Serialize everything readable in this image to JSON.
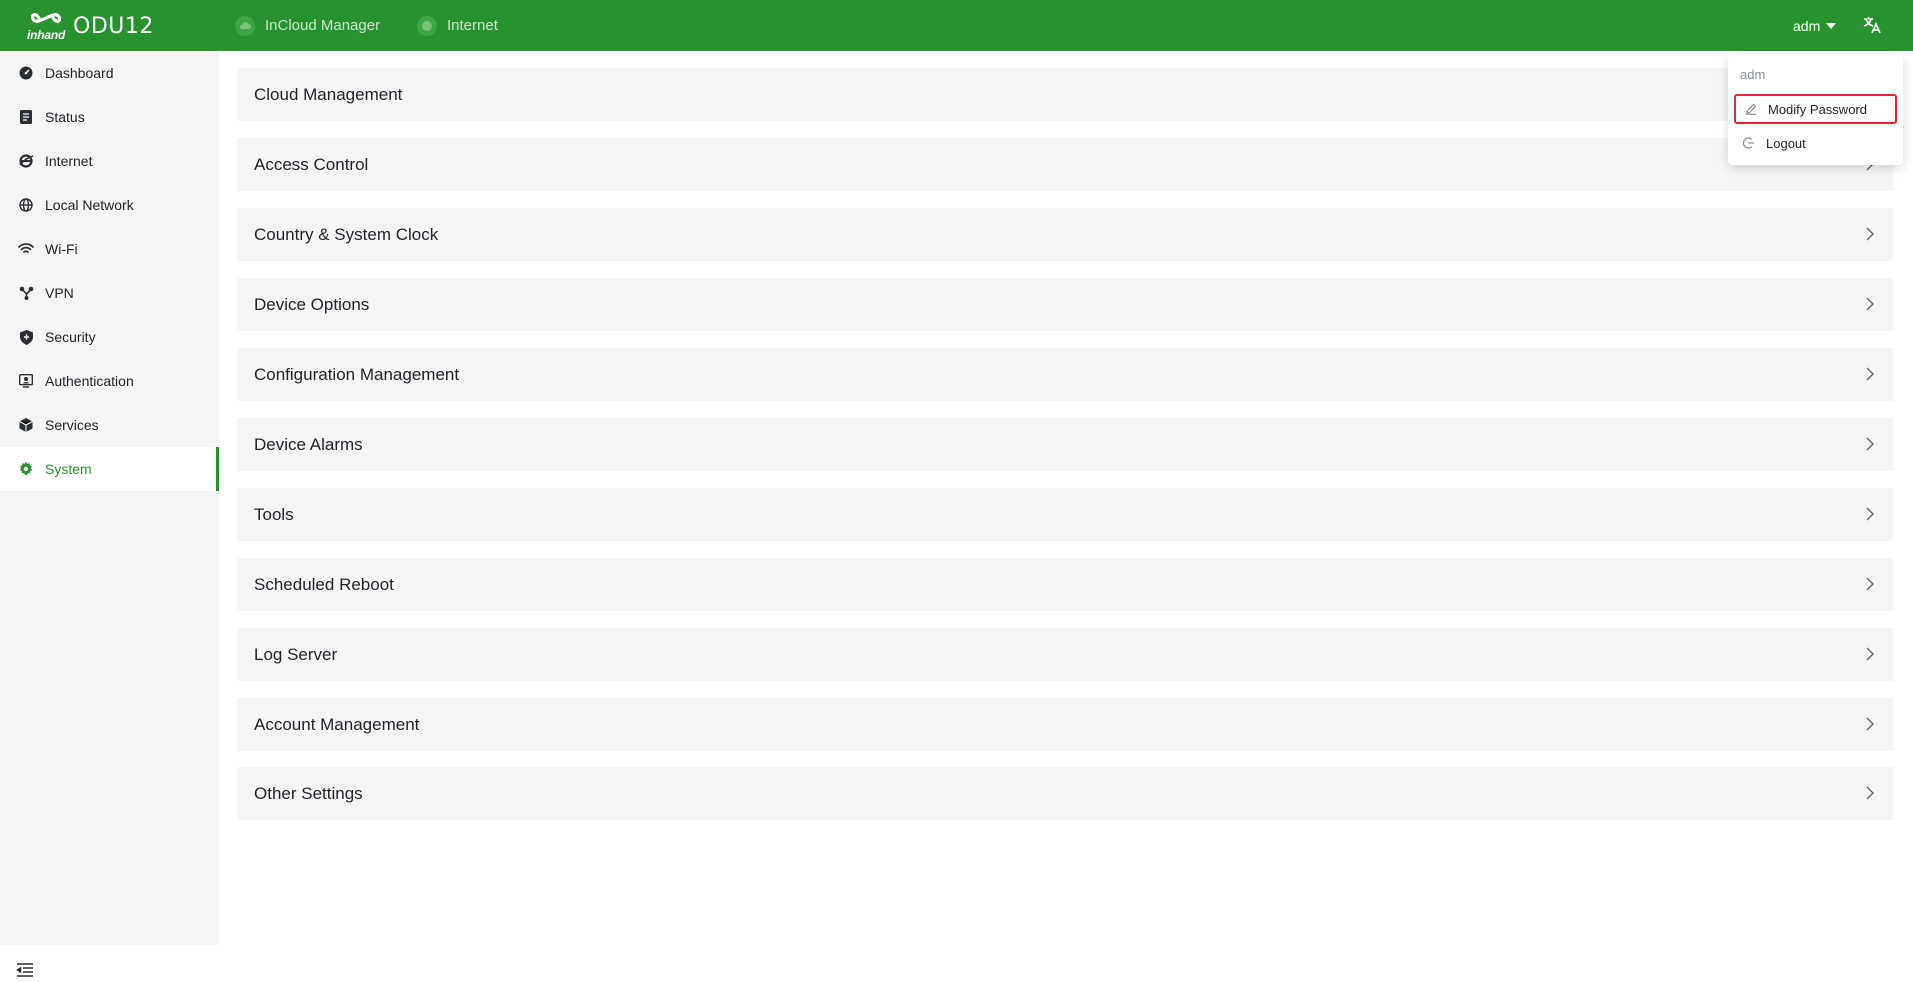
{
  "header": {
    "brand_sub": "inhand",
    "brand_name": "ODU12",
    "cloud_status": "InCloud Manager",
    "internet_status": "Internet",
    "user": "adm",
    "lang_icon": "translate-icon",
    "accent_color": "#28922f"
  },
  "sidebar": {
    "items": [
      {
        "label": "Dashboard",
        "icon": "dashboard-icon"
      },
      {
        "label": "Status",
        "icon": "status-icon"
      },
      {
        "label": "Internet",
        "icon": "internet-icon"
      },
      {
        "label": "Local Network",
        "icon": "globe-icon"
      },
      {
        "label": "Wi-Fi",
        "icon": "wifi-icon"
      },
      {
        "label": "VPN",
        "icon": "vpn-icon"
      },
      {
        "label": "Security",
        "icon": "shield-icon"
      },
      {
        "label": "Authentication",
        "icon": "authentication-icon"
      },
      {
        "label": "Services",
        "icon": "cube-icon"
      },
      {
        "label": "System",
        "icon": "gear-icon",
        "active": true
      }
    ],
    "collapse_icon": "menu-fold-icon"
  },
  "main": {
    "panels": [
      {
        "title": "Cloud Management"
      },
      {
        "title": "Access Control"
      },
      {
        "title": "Country & System Clock"
      },
      {
        "title": "Device Options"
      },
      {
        "title": "Configuration Management"
      },
      {
        "title": "Device Alarms"
      },
      {
        "title": "Tools"
      },
      {
        "title": "Scheduled Reboot"
      },
      {
        "title": "Log Server"
      },
      {
        "title": "Account Management"
      },
      {
        "title": "Other Settings"
      }
    ]
  },
  "dropdown": {
    "header": "adm",
    "items": [
      {
        "label": "Modify Password",
        "icon": "edit-icon",
        "highlighted": true,
        "highlight_color": "#e5242b"
      },
      {
        "label": "Logout",
        "icon": "logout-icon"
      }
    ]
  }
}
